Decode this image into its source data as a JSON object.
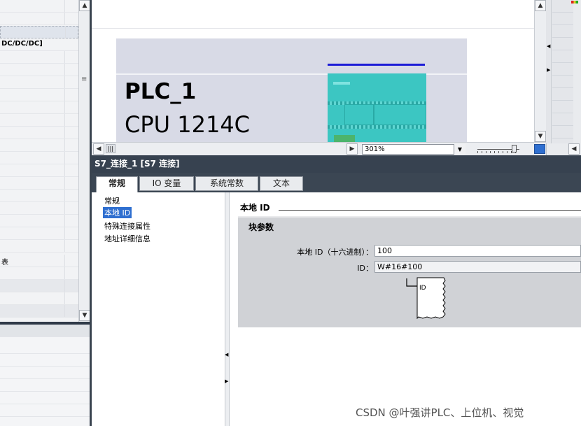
{
  "tree": {
    "selected_row_text": "",
    "cpu_type_text": "DC/DC/DC]",
    "table_label": "表"
  },
  "device": {
    "plc_name": "PLC_1",
    "cpu_model": "CPU 1214C"
  },
  "zoom": {
    "value": "301%"
  },
  "inspector": {
    "title": "S7_连接_1 [S7 连接]",
    "tabs": [
      {
        "label": "常规"
      },
      {
        "label": "IO 变量"
      },
      {
        "label": "系统常数"
      },
      {
        "label": "文本"
      }
    ],
    "nav": [
      {
        "label": "常规"
      },
      {
        "label": "本地 ID"
      },
      {
        "label": "特殊连接属性"
      },
      {
        "label": "地址详细信息"
      }
    ],
    "section_title": "本地 ID",
    "block_params_title": "块参数",
    "fields": {
      "local_id_hex_label": "本地 ID（十六进制）：",
      "local_id_hex_value": "100",
      "id_label": "ID：",
      "id_value": "W#16#100"
    },
    "block_pin_label": "ID"
  },
  "watermark": "CSDN @叶强讲PLC、上位机、视觉"
}
